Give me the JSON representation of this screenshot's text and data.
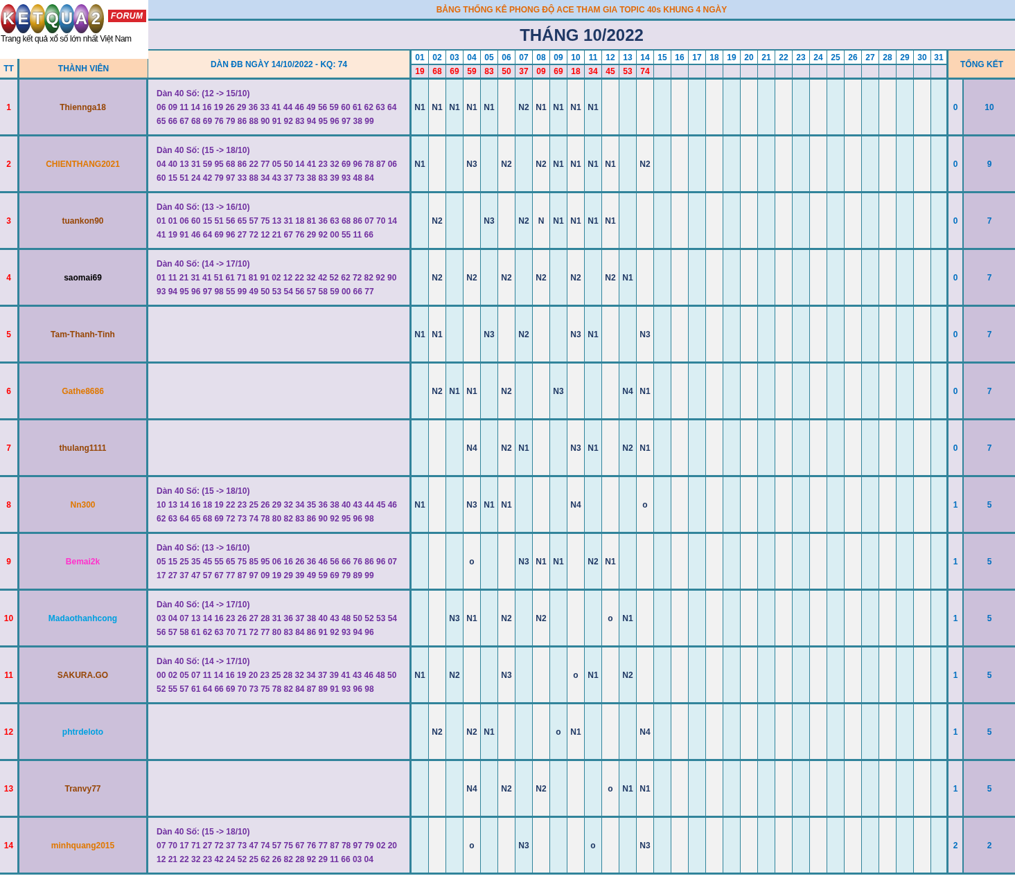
{
  "logo": {
    "letters": [
      "K",
      "E",
      "T",
      "Q",
      "U",
      "A",
      "2"
    ],
    "badge": "FORUM",
    "tagline": "Trang kết quả xổ số lớn nhất Việt Nam"
  },
  "title": "BẢNG THỐNG KÊ PHONG ĐỘ ACE THAM GIA TOPIC 40s KHUNG 4 NGÀY",
  "month": "THÁNG 10/2022",
  "columns": {
    "tt": "TT",
    "member": "THÀNH VIÊN",
    "dan": "DÀN ĐB NGÀY 14/10/2022 - KQ: 74",
    "total": "TỔNG KẾT"
  },
  "days": [
    "01",
    "02",
    "03",
    "04",
    "05",
    "06",
    "07",
    "08",
    "09",
    "10",
    "11",
    "12",
    "13",
    "14",
    "15",
    "16",
    "17",
    "18",
    "19",
    "20",
    "21",
    "22",
    "23",
    "24",
    "25",
    "26",
    "27",
    "28",
    "29",
    "30",
    "31"
  ],
  "results": [
    "19",
    "68",
    "69",
    "59",
    "83",
    "50",
    "37",
    "09",
    "69",
    "18",
    "34",
    "45",
    "53",
    "74"
  ],
  "rows": [
    {
      "tt": "1",
      "member": "Thiennga18",
      "color": "#974706",
      "dan": {
        "heading": "Dàn 40 Số: (12 -> 15/10)",
        "lines": [
          "06 09 11 14 16 19 26 29 36 33 41 44 46 49 56 59 60 61 62 63 64",
          "65 66 67 68 69 76 79 86 88 90 91 92 83 94 95 96 97 38 99"
        ]
      },
      "marks": [
        {
          "kind": "mark",
          "text": "N1"
        },
        {
          "kind": "mark",
          "text": "N1"
        },
        {
          "kind": "mark",
          "text": "N1"
        },
        {
          "kind": "mark",
          "text": "N1"
        },
        {
          "kind": "mark",
          "text": "N1"
        },
        {
          "kind": "blank"
        },
        {
          "kind": "mark",
          "text": "N2"
        },
        {
          "kind": "mark",
          "text": "N1"
        },
        {
          "kind": "mark",
          "text": "N1"
        },
        {
          "kind": "mark",
          "text": "N1"
        },
        {
          "kind": "mark",
          "text": "N1"
        }
      ],
      "total_a": "0",
      "total_b": "10"
    },
    {
      "tt": "2",
      "member": "CHIENTHANG2021",
      "color": "#e07800",
      "dan": {
        "heading": "Dàn 40 Số: (15 -> 18/10)",
        "lines": [
          "04 40 13 31 59 95 68 86 22 77 05 50 14 41 23 32 69 96 78 87 06",
          "60 15 51 24 42 79 97 33 88 34 43 37 73 38 83 39 93 48 84"
        ]
      },
      "marks": [
        {
          "kind": "mark",
          "text": "N1"
        },
        {
          "kind": "blank"
        },
        {
          "kind": "blank"
        },
        {
          "kind": "mark",
          "text": "N3"
        },
        {
          "kind": "blank"
        },
        {
          "kind": "mark",
          "text": "N2"
        },
        {
          "kind": "blank"
        },
        {
          "kind": "mark",
          "text": "N2"
        },
        {
          "kind": "mark",
          "text": "N1"
        },
        {
          "kind": "mark",
          "text": "N1"
        },
        {
          "kind": "mark",
          "text": "N1"
        },
        {
          "kind": "mark",
          "text": "N1"
        },
        {
          "kind": "blank"
        },
        {
          "kind": "mark",
          "text": "N2"
        }
      ],
      "total_a": "0",
      "total_b": "9"
    },
    {
      "tt": "3",
      "member": "tuankon90",
      "color": "#974706",
      "dan": {
        "heading": "Dàn 40 Số: (13 -> 16/10)",
        "lines": [
          "01 01 06 60 15 51 56 65 57 75 13 31 18 81 36 63 68 86 07 70 14",
          "41 19 91 46 64 69 96 27 72 12 21 67 76 29 92 00 55 11 66"
        ]
      },
      "marks": [
        {
          "kind": "blank"
        },
        {
          "kind": "mark",
          "text": "N2"
        },
        {
          "kind": "blank"
        },
        {
          "kind": "blank"
        },
        {
          "kind": "mark",
          "text": "N3"
        },
        {
          "kind": "blank"
        },
        {
          "kind": "mark",
          "text": "N2"
        },
        {
          "kind": "mark",
          "text": "N"
        },
        {
          "kind": "mark",
          "text": "N1"
        },
        {
          "kind": "mark",
          "text": "N1"
        },
        {
          "kind": "mark",
          "text": "N1"
        },
        {
          "kind": "mark",
          "text": "N1"
        }
      ],
      "total_a": "0",
      "total_b": "7"
    },
    {
      "tt": "4",
      "member": "saomai69",
      "color": "#000000",
      "dan": {
        "heading": "Dàn 40 Số: (14 -> 17/10)",
        "lines": [
          "01 11 21 31 41 51 61 71 81 91 02 12 22 32 42 52 62 72 82 92 90",
          "93 94 95 96 97 98 55 99 49 50 53 54 56 57 58 59 00 66 77"
        ]
      },
      "marks": [
        {
          "kind": "blank"
        },
        {
          "kind": "mark",
          "text": "N2"
        },
        {
          "kind": "blank"
        },
        {
          "kind": "mark",
          "text": "N2"
        },
        {
          "kind": "blank"
        },
        {
          "kind": "mark",
          "text": "N2"
        },
        {
          "kind": "blank"
        },
        {
          "kind": "mark",
          "text": "N2"
        },
        {
          "kind": "blank"
        },
        {
          "kind": "mark",
          "text": "N2"
        },
        {
          "kind": "blank"
        },
        {
          "kind": "mark",
          "text": "N2"
        },
        {
          "kind": "mark",
          "text": "N1"
        }
      ],
      "total_a": "0",
      "total_b": "7"
    },
    {
      "tt": "5",
      "member": "Tam-Thanh-Tinh",
      "color": "#974706",
      "marks": [
        {
          "kind": "mark",
          "text": "N1"
        },
        {
          "kind": "mark",
          "text": "N1"
        },
        {
          "kind": "blank"
        },
        {
          "kind": "blank"
        },
        {
          "kind": "mark",
          "text": "N3"
        },
        {
          "kind": "blank"
        },
        {
          "kind": "mark",
          "text": "N2"
        },
        {
          "kind": "blank"
        },
        {
          "kind": "blank"
        },
        {
          "kind": "mark",
          "text": "N3"
        },
        {
          "kind": "mark",
          "text": "N1"
        },
        {
          "kind": "blank"
        },
        {
          "kind": "blank"
        },
        {
          "kind": "mark",
          "text": "N3"
        }
      ],
      "total_a": "0",
      "total_b": "7"
    },
    {
      "tt": "6",
      "member": "Gathe8686",
      "color": "#e07800",
      "marks": [
        {
          "kind": "blank"
        },
        {
          "kind": "mark",
          "text": "N2"
        },
        {
          "kind": "mark",
          "text": "N1"
        },
        {
          "kind": "mark",
          "text": "N1"
        },
        {
          "kind": "blank"
        },
        {
          "kind": "mark",
          "text": "N2"
        },
        {
          "kind": "blank"
        },
        {
          "kind": "blank"
        },
        {
          "kind": "mark",
          "text": "N3"
        },
        {
          "kind": "blank"
        },
        {
          "kind": "blank"
        },
        {
          "kind": "blank"
        },
        {
          "kind": "mark",
          "text": "N4"
        },
        {
          "kind": "mark",
          "text": "N1"
        }
      ],
      "total_a": "0",
      "total_b": "7"
    },
    {
      "tt": "7",
      "member": "thulang1111",
      "color": "#974706",
      "marks": [
        {
          "kind": "blank"
        },
        {
          "kind": "blank"
        },
        {
          "kind": "blank"
        },
        {
          "kind": "mark",
          "text": "N4"
        },
        {
          "kind": "blank"
        },
        {
          "kind": "mark",
          "text": "N2"
        },
        {
          "kind": "mark",
          "text": "N1"
        },
        {
          "kind": "blank"
        },
        {
          "kind": "blank"
        },
        {
          "kind": "mark",
          "text": "N3"
        },
        {
          "kind": "mark",
          "text": "N1"
        },
        {
          "kind": "blank"
        },
        {
          "kind": "mark",
          "text": "N2"
        },
        {
          "kind": "mark",
          "text": "N1"
        }
      ],
      "total_a": "0",
      "total_b": "7"
    },
    {
      "tt": "8",
      "member": "Nn300",
      "color": "#e07800",
      "dan": {
        "heading": "Dàn 40 Số: (15 -> 18/10)",
        "lines": [
          "10 13 14 16 18 19 22 23 25 26 29 32 34 35 36 38 40 43 44 45 46",
          "62 63 64 65 68 69 72 73 74 78 80 82 83 86 90 92 95 96 98"
        ]
      },
      "marks": [
        {
          "kind": "mark",
          "text": "N1"
        },
        {
          "kind": "blank"
        },
        {
          "kind": "blank"
        },
        {
          "kind": "mark",
          "text": "N3"
        },
        {
          "kind": "mark",
          "text": "N1"
        },
        {
          "kind": "mark",
          "text": "N1"
        },
        {
          "kind": "blank"
        },
        {
          "kind": "blank"
        },
        {
          "kind": "blank"
        },
        {
          "kind": "mark",
          "text": "N4"
        },
        {
          "kind": "blank"
        },
        {
          "kind": "blank"
        },
        {
          "kind": "blank"
        },
        {
          "kind": "mark",
          "text": "o"
        }
      ],
      "total_a": "1",
      "total_b": "5"
    },
    {
      "tt": "9",
      "member": "Bemai2k",
      "color": "#ff33cc",
      "dan": {
        "heading": "Dàn 40 Số: (13 -> 16/10)",
        "lines": [
          "05 15 25 35 45 55 65 75 85 95 06 16 26 36 46 56 66 76 86 96 07",
          "17 27 37 47 57 67 77 87 97 09 19 29 39 49 59 69 79 89 99"
        ]
      },
      "marks": [
        {
          "kind": "blank"
        },
        {
          "kind": "blank"
        },
        {
          "kind": "blank"
        },
        {
          "kind": "mark",
          "text": "o"
        },
        {
          "kind": "blank"
        },
        {
          "kind": "blank"
        },
        {
          "kind": "mark",
          "text": "N3"
        },
        {
          "kind": "mark",
          "text": "N1"
        },
        {
          "kind": "mark",
          "text": "N1"
        },
        {
          "kind": "blank"
        },
        {
          "kind": "mark",
          "text": "N2"
        },
        {
          "kind": "mark",
          "text": "N1"
        }
      ],
      "total_a": "1",
      "total_b": "5"
    },
    {
      "tt": "10",
      "member": "Madaothanhcong",
      "color": "#00a0e0",
      "dan": {
        "heading": "Dàn 40 Số: (14 -> 17/10)",
        "lines": [
          "03 04 07 13 14 16 23 26 27 28 31 36 37 38 40 43 48 50 52 53 54",
          "56 57 58 61 62 63 70 71 72 77 80 83 84 86 91 92 93 94 96"
        ]
      },
      "marks": [
        {
          "kind": "blank"
        },
        {
          "kind": "blank"
        },
        {
          "kind": "mark",
          "text": "N3"
        },
        {
          "kind": "mark",
          "text": "N1"
        },
        {
          "kind": "blank"
        },
        {
          "kind": "mark",
          "text": "N2"
        },
        {
          "kind": "blank"
        },
        {
          "kind": "mark",
          "text": "N2"
        },
        {
          "kind": "blank"
        },
        {
          "kind": "blank"
        },
        {
          "kind": "blank"
        },
        {
          "kind": "mark",
          "text": "o"
        },
        {
          "kind": "mark",
          "text": "N1"
        }
      ],
      "total_a": "1",
      "total_b": "5"
    },
    {
      "tt": "11",
      "member": "SAKURA.GO",
      "color": "#974706",
      "dan": {
        "heading": "Dàn 40 Số: (14 -> 17/10)",
        "lines": [
          "00 02 05 07 11 14 16 19 20 23 25 28 32 34 37 39 41 43 46 48 50",
          "52 55 57 61 64 66 69 70 73 75 78 82 84 87 89 91 93 96 98"
        ]
      },
      "marks": [
        {
          "kind": "mark",
          "text": "N1"
        },
        {
          "kind": "blank"
        },
        {
          "kind": "mark",
          "text": "N2"
        },
        {
          "kind": "blank"
        },
        {
          "kind": "blank"
        },
        {
          "kind": "mark",
          "text": "N3"
        },
        {
          "kind": "blank"
        },
        {
          "kind": "blank"
        },
        {
          "kind": "blank"
        },
        {
          "kind": "mark",
          "text": "o"
        },
        {
          "kind": "mark",
          "text": "N1"
        },
        {
          "kind": "blank"
        },
        {
          "kind": "mark",
          "text": "N2"
        }
      ],
      "total_a": "1",
      "total_b": "5"
    },
    {
      "tt": "12",
      "member": "phtrdeloto",
      "color": "#00a0e0",
      "marks": [
        {
          "kind": "blank"
        },
        {
          "kind": "mark",
          "text": "N2"
        },
        {
          "kind": "blank"
        },
        {
          "kind": "mark",
          "text": "N2"
        },
        {
          "kind": "mark",
          "text": "N1"
        },
        {
          "kind": "blank"
        },
        {
          "kind": "blank"
        },
        {
          "kind": "blank"
        },
        {
          "kind": "mark",
          "text": "o"
        },
        {
          "kind": "mark",
          "text": "N1"
        },
        {
          "kind": "blank"
        },
        {
          "kind": "blank"
        },
        {
          "kind": "blank"
        },
        {
          "kind": "mark",
          "text": "N4"
        }
      ],
      "total_a": "1",
      "total_b": "5"
    },
    {
      "tt": "13",
      "member": "Tranvy77",
      "color": "#974706",
      "marks": [
        {
          "kind": "blank"
        },
        {
          "kind": "blank"
        },
        {
          "kind": "blank"
        },
        {
          "kind": "mark",
          "text": "N4"
        },
        {
          "kind": "blank"
        },
        {
          "kind": "mark",
          "text": "N2"
        },
        {
          "kind": "blank"
        },
        {
          "kind": "mark",
          "text": "N2"
        },
        {
          "kind": "blank"
        },
        {
          "kind": "blank"
        },
        {
          "kind": "blank"
        },
        {
          "kind": "mark",
          "text": "o"
        },
        {
          "kind": "mark",
          "text": "N1"
        },
        {
          "kind": "mark",
          "text": "N1"
        }
      ],
      "total_a": "1",
      "total_b": "5"
    },
    {
      "tt": "14",
      "member": "minhquang2015",
      "color": "#e07800",
      "dan": {
        "heading": "Dàn 40 Số: (15 -> 18/10)",
        "lines": [
          "07 70 17 71 27 72 37 73 47 74 57 75 67 76 77 87 78 97 79 02 20",
          "12 21 22 32 23 42 24 52 25 62 26 82 28 92 29 11 66 03 04"
        ]
      },
      "marks": [
        {
          "kind": "blank"
        },
        {
          "kind": "blank"
        },
        {
          "kind": "blank"
        },
        {
          "kind": "mark",
          "text": "o"
        },
        {
          "kind": "blank"
        },
        {
          "kind": "blank"
        },
        {
          "kind": "mark",
          "text": "N3"
        },
        {
          "kind": "blank"
        },
        {
          "kind": "blank"
        },
        {
          "kind": "blank"
        },
        {
          "kind": "mark",
          "text": "o"
        },
        {
          "kind": "blank"
        },
        {
          "kind": "blank"
        },
        {
          "kind": "mark",
          "text": "N3"
        }
      ],
      "total_a": "2",
      "total_b": "2"
    }
  ]
}
